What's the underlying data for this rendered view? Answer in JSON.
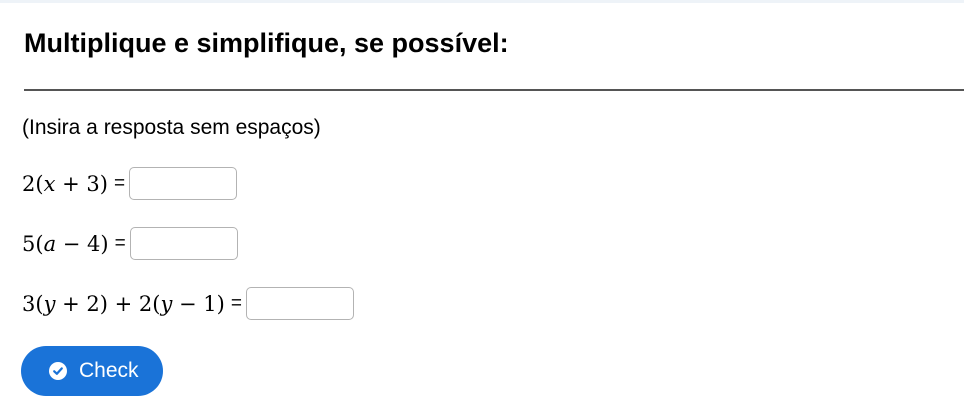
{
  "title": "Multiplique e simplifique, se possível:",
  "instructions": "(Insira a resposta sem espaços)",
  "equals": "=",
  "problems": [
    {
      "prefix": "2(",
      "var": "x",
      "op": " + ",
      "num": "3",
      "suffix": ")",
      "answer_value": ""
    },
    {
      "prefix": "5(",
      "var": "a",
      "op": " − ",
      "num": "4",
      "suffix": ")",
      "answer_value": ""
    },
    {
      "p3_a": "3(",
      "var1": "y",
      "op1": " + ",
      "num1": "2",
      "mid": ") + 2(",
      "var2": "y",
      "op2": " − ",
      "num2": "1",
      "suffix": ")",
      "answer_value": ""
    }
  ],
  "check_button": {
    "label": "Check",
    "icon": "check-circle-icon"
  },
  "colors": {
    "button_bg": "#1a73d8",
    "divider": "#555555",
    "input_border": "#b3b3b3"
  }
}
